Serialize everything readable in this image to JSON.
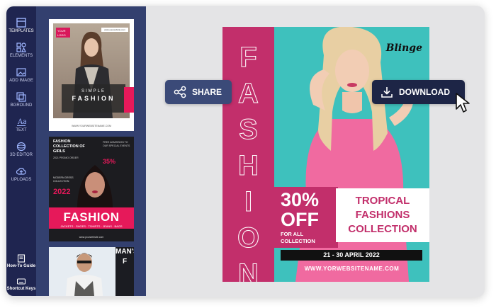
{
  "sidebar": {
    "items": [
      {
        "label": "TEMPLATES",
        "icon": "templates-icon"
      },
      {
        "label": "ELEMENTS",
        "icon": "elements-icon"
      },
      {
        "label": "ADD IMAGE",
        "icon": "add-image-icon"
      },
      {
        "label": "BGROUND",
        "icon": "background-icon"
      },
      {
        "label": "TEXT",
        "icon": "text-icon"
      },
      {
        "label": "3D EDITOR",
        "icon": "3d-editor-icon"
      },
      {
        "label": "UPLOADS",
        "icon": "uploads-icon"
      }
    ],
    "bottom": [
      {
        "label": "How-To Guide",
        "icon": "guide-icon"
      },
      {
        "label": "Shortcut Keys",
        "icon": "keyboard-icon"
      }
    ]
  },
  "templates": {
    "t1": {
      "logo": "YOUR LOGO",
      "url": "www.yourwebsite.com",
      "subtitle": "SIMPLE",
      "title": "FASHION",
      "footer": "WWW.YOURWEBSITENAME.COM"
    },
    "t2": {
      "heading": "FASHION COLLECTION OF GIRLS",
      "subheading": "2021 PROMO ORDER",
      "discount": "35%",
      "side_text": "FREE ADMISSION TO OUR SPECIAL EVENTS",
      "year_note": "MODERN DRESS COLLECTION",
      "year": "2022",
      "title": "FASHION",
      "sub": "JACKETS · SHOES · TSHIRTS · JEANS · BAGS",
      "web": "www.yourwebsite.com"
    },
    "t3": {
      "side": "MAN'S F"
    }
  },
  "buttons": {
    "share": "SHARE",
    "download": "DOWNLOAD"
  },
  "poster": {
    "vertical_word": [
      "F",
      "A",
      "S",
      "H",
      "I",
      "O",
      "N"
    ],
    "brand": "Blinge",
    "discount": "30%",
    "off": "OFF",
    "for_all": "FOR ALL",
    "collection": "COLLECTION",
    "headline": [
      "TROPICAL",
      "FASHIONS",
      "COLLECTION"
    ],
    "dates": "21 - 30 APRIL 2022",
    "website": "WWW.YORWEBSITENAME.COM"
  },
  "colors": {
    "sidebar": "#1f2550",
    "panel": "#33406f",
    "accent_pink": "#c22f6b",
    "teal": "#3ec1bd",
    "download_btn": "#1d2546",
    "share_btn": "#3b4a78"
  }
}
